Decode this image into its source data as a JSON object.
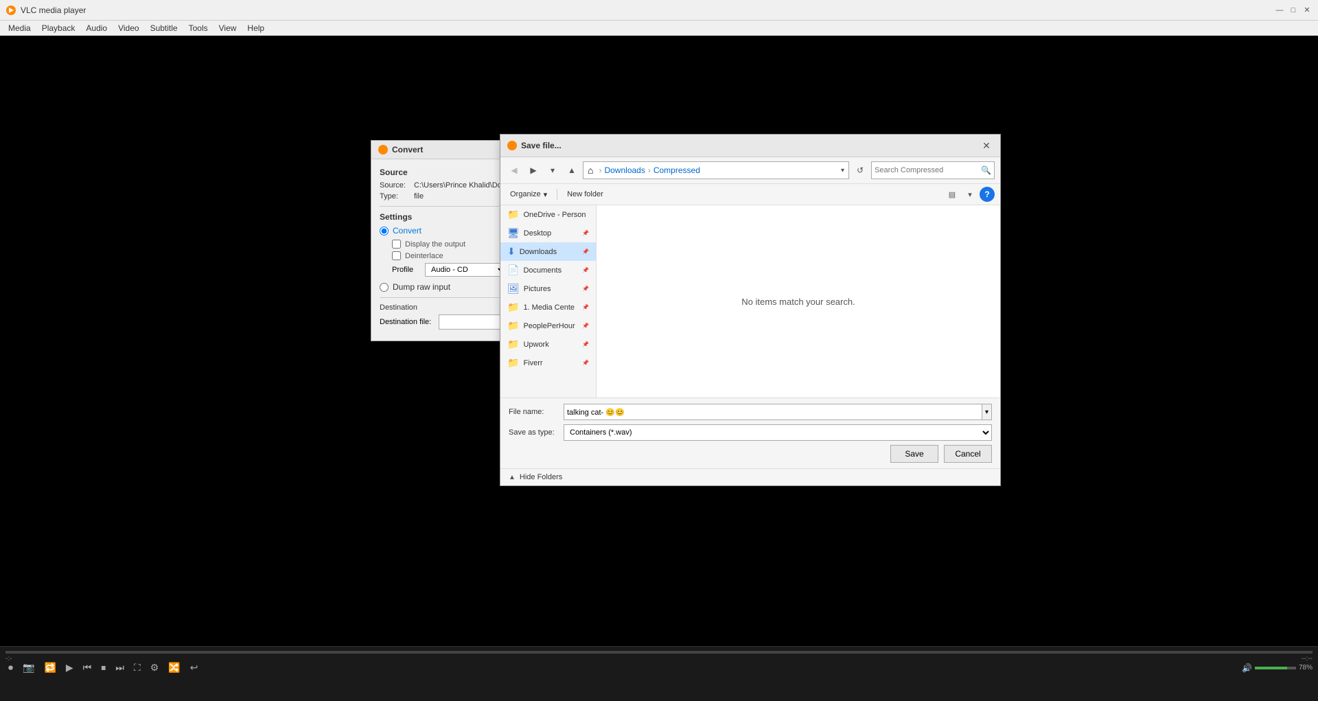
{
  "app": {
    "title": "VLC media player",
    "icon": "🎬"
  },
  "titlebar": {
    "minimize": "—",
    "maximize": "□",
    "close": "✕"
  },
  "menubar": {
    "items": [
      "Media",
      "Playback",
      "Audio",
      "Video",
      "Subtitle",
      "Tools",
      "View",
      "Help"
    ]
  },
  "controls": {
    "time_left": "-:-",
    "time_right": "--:--",
    "volume_percent": "78%",
    "volume_width": 78
  },
  "convert_dialog": {
    "title": "Convert",
    "source_label": "Source",
    "source_path": "C:\\Users\\Prince Khalid\\Dow",
    "type_label": "Type:",
    "type_value": "file",
    "settings_label": "Settings",
    "convert_radio": "Convert",
    "display_output": "Display the output",
    "deinterlace": "Deinterlace",
    "profile_label": "Profile",
    "profile_value": "Audio - CD",
    "dump_raw": "Dump raw input",
    "destination_label": "Destination",
    "destination_file_label": "Destination file:"
  },
  "save_dialog": {
    "title": "Save file...",
    "breadcrumb": {
      "home": "⌂",
      "downloads": "Downloads",
      "compressed": "Compressed"
    },
    "search_placeholder": "Search Compressed",
    "organize_label": "Organize",
    "new_folder_label": "New folder",
    "no_items_message": "No items match your search.",
    "left_panel": [
      {
        "name": "OneDrive - Person",
        "icon": "📁",
        "color": "yellow",
        "pinned": false
      },
      {
        "name": "Desktop",
        "icon": "🖥",
        "color": "blue",
        "pinned": true
      },
      {
        "name": "Downloads",
        "icon": "⬇",
        "color": "blue",
        "pinned": true
      },
      {
        "name": "Documents",
        "icon": "📄",
        "color": "blue",
        "pinned": true
      },
      {
        "name": "Pictures",
        "icon": "🖼",
        "color": "blue",
        "pinned": true
      },
      {
        "name": "1. Media Cente",
        "icon": "📁",
        "color": "yellow",
        "pinned": true
      },
      {
        "name": "PeoplePerHour",
        "icon": "📁",
        "color": "yellow",
        "pinned": true
      },
      {
        "name": "Upwork",
        "icon": "📁",
        "color": "yellow",
        "pinned": true
      },
      {
        "name": "Fiverr",
        "icon": "📁",
        "color": "yellow",
        "pinned": true
      }
    ],
    "file_name_label": "File name:",
    "file_name_value": "talking cat- 😊😊",
    "save_as_type_label": "Save as type:",
    "save_as_type_value": "Containers (*.wav)",
    "save_button": "Save",
    "cancel_button": "Cancel",
    "hide_folders_label": "Hide Folders"
  }
}
